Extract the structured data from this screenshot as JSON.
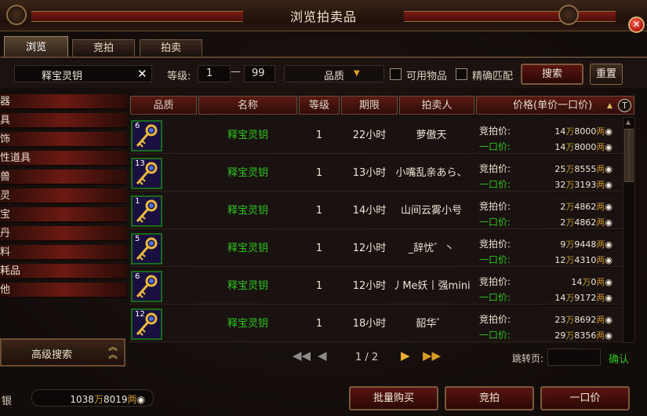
{
  "window": {
    "title": "浏览拍卖品",
    "close_glyph": "✕"
  },
  "tabs": [
    {
      "label": "浏览",
      "active": true
    },
    {
      "label": "竞拍",
      "active": false
    },
    {
      "label": "拍卖",
      "active": false
    }
  ],
  "search": {
    "keyword": "释宝灵钥",
    "clear_glyph": "✕",
    "level_label": "等级:",
    "level_min": "1",
    "level_dash": "—",
    "level_max": "99",
    "quality_label": "品质",
    "usable_label": "可用物品",
    "exact_label": "精确匹配",
    "search_button": "搜索",
    "reset_button": "重置"
  },
  "categories": [
    "器",
    "具",
    "饰",
    "性道具",
    "兽",
    "灵",
    "宝",
    "丹",
    "料",
    "耗品",
    "他"
  ],
  "advanced_search": {
    "label": "高级搜索",
    "icon": "double-chevron-up-icon"
  },
  "table": {
    "headers": [
      "品质",
      "名称",
      "等级",
      "期限",
      "拍卖人",
      "价格(单价一口价)"
    ],
    "sort_glyph": "▲",
    "tooltip_glyph": "T",
    "bid_label": "竞拍价:",
    "buyout_label": "一口价:",
    "wan": "万",
    "liang": "两",
    "rows": [
      {
        "quality": "6",
        "name": "释宝灵钥",
        "level": "1",
        "duration": "22小时",
        "seller": "萝傲天",
        "bid_wan": "14",
        "bid_rest": "8000",
        "buy_wan": "14",
        "buy_rest": "8000"
      },
      {
        "quality": "13",
        "name": "释宝灵钥",
        "level": "1",
        "duration": "13小时",
        "seller": "小嘴乱亲あら、",
        "bid_wan": "25",
        "bid_rest": "8555",
        "buy_wan": "32",
        "buy_rest": "3193"
      },
      {
        "quality": "1",
        "name": "释宝灵钥",
        "level": "1",
        "duration": "14小时",
        "seller": "山间云雾小号",
        "bid_wan": "2",
        "bid_rest": "4862",
        "buy_wan": "2",
        "buy_rest": "4862"
      },
      {
        "quality": "5",
        "name": "释宝灵钥",
        "level": "1",
        "duration": "12小时",
        "seller": "_辞忧゛丶",
        "bid_wan": "9",
        "bid_rest": "9448",
        "buy_wan": "12",
        "buy_rest": "4310"
      },
      {
        "quality": "6",
        "name": "释宝灵钥",
        "level": "1",
        "duration": "12小时",
        "seller": "丿Me妖丨强mini",
        "bid_wan": "14",
        "bid_rest": "0",
        "buy_wan": "14",
        "buy_rest": "9172"
      },
      {
        "quality": "12",
        "name": "释宝灵钥",
        "level": "1",
        "duration": "18小时",
        "seller": "韶华゛",
        "bid_wan": "23",
        "bid_rest": "8692",
        "buy_wan": "29",
        "buy_rest": "8356"
      }
    ]
  },
  "pager": {
    "page": "1 / 2",
    "jump_label": "跳转页:",
    "jump_value": "",
    "confirm_label": "确认"
  },
  "footer": {
    "silver_label": "银",
    "silver_wan": "1038",
    "silver_rest": "8019",
    "bulk_buy_button": "批量购买",
    "bid_button": "竞拍",
    "buyout_button": "一口价"
  },
  "colors": {
    "item_name": "#2ec41e",
    "buyout_label": "#2ec41e",
    "accent_gold": "#c09a30",
    "title_red": "#7a1c14"
  }
}
